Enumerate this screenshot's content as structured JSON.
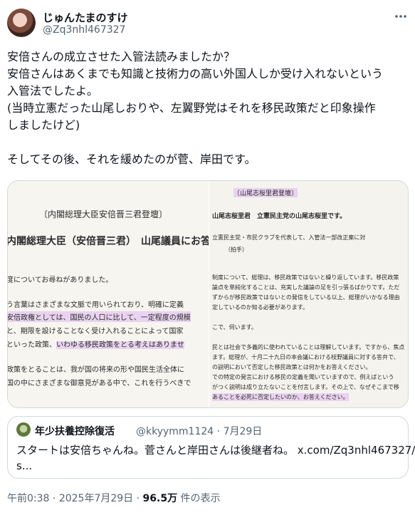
{
  "author": {
    "display_name": "じゅんたまのすけ",
    "handle": "@Zq3nhl467327"
  },
  "icons": {
    "more": "more-horizontal-icon",
    "avatar": "user-avatar",
    "quote_avatar": "quoted-user-avatar"
  },
  "tweet": {
    "lines": [
      "安倍さんの成立させた入管法読みましたか？",
      "安倍さんはあくまでも知識と技術力の高い外国人しか受け入れないという",
      "入管法でしたよ。",
      "(当時立憲だった山尾しおりや、左翼野党はそれを移民政策だと印象操作",
      "しましたけど)",
      "",
      "そしてその後、それを緩めたのが菅、岸田です。"
    ]
  },
  "media": {
    "left": {
      "lines": [
        "〔内閣総理大臣安倍晋三君登壇〕",
        "内閣総理大臣（安倍晋三君）　山尾議員にお答",
        "度についてお尋ねがありました。",
        "う言葉はさまざまな文脈で用いられており、明確に定義",
        "安倍政権としては、国民の人口に比して、一定程度の規模",
        "と、期限を設けることなく受け入れることによって国家",
        "といった政策、いわゆる移民政策をとる考えはありませ",
        "政策をとることは、我が国の将来の形や国民生活全体に",
        "国の中にさまざまな御意見がある中で、これを行うべきで"
      ]
    },
    "right": {
      "lines": [
        "〔山尾志桜里君登壇〕",
        "山尾志桜里君　立憲民主党の山尾志桜里です。",
        "立憲民主党・市民クラブを代表して、入管法一部改正案に対",
        "（拍手）",
        "制度について、総理は、移民政策ではないと繰り返しています。移民政策",
        "論点を単純化することは、充実した議論の足を引っ張るばかりです。ただ",
        "ずからが移民政策ではないとの発信をしている以上、総理がいかなる理由",
        "定しているのか知る必要があります。",
        "こで、伺います。",
        "民とは社会で多義的に使われていることは理解しています。ですから、焦点",
        "ます。総理が、十月二十九日の本会議における枝野議員に対する答弁で、",
        "の説明において否定した移民政策とは何かをお答えください。",
        "での特定の発言における移民の定義を聞いていますので、例えばという",
        "がつく説明は成り立たないことを付言します。その上で、なぜそこまで移",
        "あることを必死に否定したいのか、お答えください。"
      ]
    }
  },
  "quote": {
    "display_name": "年少扶養控除復活",
    "handle": "@kkyymm1124",
    "separator": "·",
    "date": "7月29日",
    "lines": [
      "スタートは安倍ちゃんね。菅さんと岸田さんは後継者ね。 x.com/Zq3nhl467327/",
      "s..."
    ]
  },
  "footer": {
    "time": "午前0:38",
    "separator": "·",
    "date": "2025年7月29日",
    "views_count": "96.5万",
    "views_label": "件の表示"
  }
}
